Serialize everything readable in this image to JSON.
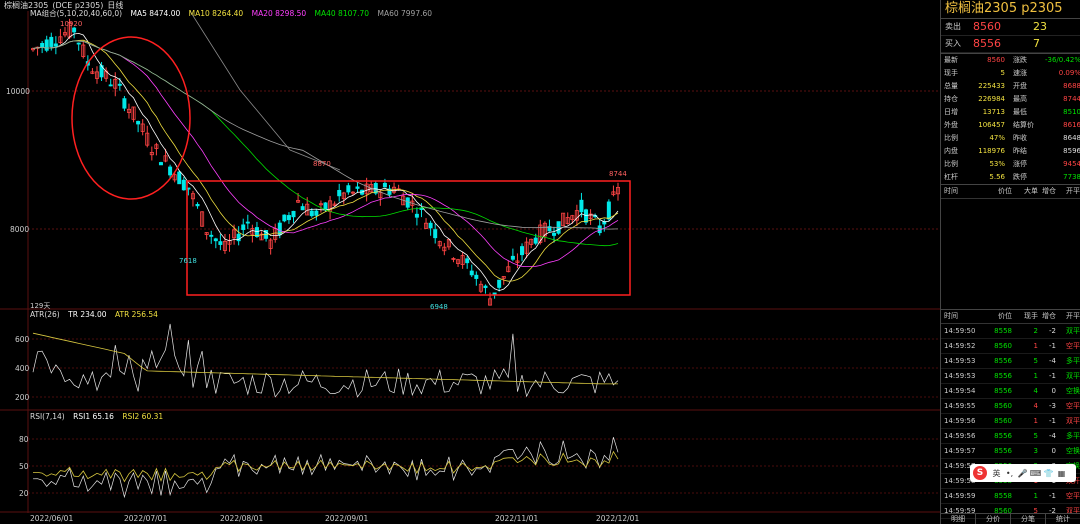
{
  "header": {
    "title": "棕榈油2305",
    "code": "(DCE p2305)",
    "period": "日线"
  },
  "ma_legend": {
    "group": "MA组合(5,10,20,40,60,0)",
    "ma5": "MA5 8474.00",
    "ma10": "MA10 8264.40",
    "ma20": "MA20 8298.50",
    "ma40": "MA40 8107.70",
    "ma60": "MA60 7997.60"
  },
  "atr_legend": {
    "name": "ATR(26)",
    "tr": "TR 234.00",
    "atr": "ATR 256.54"
  },
  "rsi_legend": {
    "name": "RSI(7,14)",
    "rsi1": "RSI1 65.16",
    "rsi2": "RSI2 60.31"
  },
  "days_label": "129天",
  "price_annotations": {
    "high_left": "10920",
    "peak_mid": "8870",
    "low_left": "7618",
    "low_mid": "6948",
    "high_right": "8744"
  },
  "y_axis_main": [
    "10000",
    "8000"
  ],
  "y_axis_atr": [
    "600",
    "400",
    "200"
  ],
  "y_axis_rsi": [
    "80",
    "50",
    "20"
  ],
  "x_axis": [
    "2022/06/01",
    "2022/07/01",
    "2022/08/01",
    "2022/09/01",
    "2022/11/01",
    "2022/12/01"
  ],
  "panel": {
    "title": "棕榈油2305  p2305",
    "ask": {
      "label": "卖出",
      "price": "8560",
      "qty": "23"
    },
    "bid": {
      "label": "买入",
      "price": "8556",
      "qty": "7"
    },
    "quotes": [
      {
        "k1": "最新",
        "v1": "8560",
        "k2": "涨跌",
        "v2": "-36/0.42%",
        "c1": "#ff4444",
        "c2": "#00e000"
      },
      {
        "k1": "现手",
        "v1": "5",
        "k2": "速涨",
        "v2": "0.09%",
        "c1": "#f0e040",
        "c2": "#ff4444"
      },
      {
        "k1": "总量",
        "v1": "225433",
        "k2": "开盘",
        "v2": "8688",
        "c1": "#f0e040",
        "c2": "#ff4444"
      },
      {
        "k1": "持仓",
        "v1": "226984",
        "k2": "最高",
        "v2": "8744",
        "c1": "#f0e040",
        "c2": "#ff4444"
      },
      {
        "k1": "日增",
        "v1": "13713",
        "k2": "最低",
        "v2": "8510",
        "c1": "#f0e040",
        "c2": "#00e000"
      },
      {
        "k1": "外盘",
        "v1": "106457",
        "k2": "结算价",
        "v2": "8616",
        "c1": "#f0e040",
        "c2": "#ff4444"
      },
      {
        "k1": "比例",
        "v1": "47%",
        "k2": "昨收",
        "v2": "8648",
        "c1": "#f0e040",
        "c2": "#dddddd"
      },
      {
        "k1": "内盘",
        "v1": "118976",
        "k2": "昨结",
        "v2": "8596",
        "c1": "#f0e040",
        "c2": "#dddddd"
      },
      {
        "k1": "比例",
        "v1": "53%",
        "k2": "涨停",
        "v2": "9454",
        "c1": "#f0e040",
        "c2": "#ff4444"
      },
      {
        "k1": "杠杆",
        "v1": "5.56",
        "k2": "跌停",
        "v2": "7738",
        "c1": "#f0e040",
        "c2": "#00e000"
      }
    ],
    "head1": [
      "时间",
      "价位",
      "大单",
      "增仓",
      "开平"
    ],
    "head2": [
      "时间",
      "价位",
      "现手",
      "增仓",
      "开平"
    ],
    "ticks": [
      {
        "t": "14:59:50",
        "p": "8558",
        "q": "2",
        "d": "-2",
        "o": "双平",
        "pc": "#00e000",
        "qc": "#00e000",
        "oc": "#00e000"
      },
      {
        "t": "14:59:52",
        "p": "8560",
        "q": "1",
        "d": "-1",
        "o": "空平",
        "pc": "#00e000",
        "qc": "#ff4444",
        "oc": "#ff4444"
      },
      {
        "t": "14:59:53",
        "p": "8556",
        "q": "5",
        "d": "-4",
        "o": "多平",
        "pc": "#00e000",
        "qc": "#00e000",
        "oc": "#00e000"
      },
      {
        "t": "14:59:53",
        "p": "8556",
        "q": "1",
        "d": "-1",
        "o": "双平",
        "pc": "#00e000",
        "qc": "#00e000",
        "oc": "#00e000"
      },
      {
        "t": "14:59:54",
        "p": "8556",
        "q": "4",
        "d": "0",
        "o": "空换",
        "pc": "#00e000",
        "qc": "#00e000",
        "oc": "#00e000"
      },
      {
        "t": "14:59:55",
        "p": "8560",
        "q": "4",
        "d": "-3",
        "o": "空平",
        "pc": "#00e000",
        "qc": "#ff4444",
        "oc": "#ff4444"
      },
      {
        "t": "14:59:56",
        "p": "8560",
        "q": "1",
        "d": "-1",
        "o": "双平",
        "pc": "#00e000",
        "qc": "#ff4444",
        "oc": "#ff4444"
      },
      {
        "t": "14:59:56",
        "p": "8556",
        "q": "5",
        "d": "-4",
        "o": "多平",
        "pc": "#00e000",
        "qc": "#00e000",
        "oc": "#00e000"
      },
      {
        "t": "14:59:57",
        "p": "8556",
        "q": "3",
        "d": "0",
        "o": "空换",
        "pc": "#00e000",
        "qc": "#00e000",
        "oc": "#00e000"
      },
      {
        "t": "14:59:57",
        "p": "8556",
        "q": "2",
        "d": "0",
        "o": "空换",
        "pc": "#00e000",
        "qc": "#00e000",
        "oc": "#00e000"
      },
      {
        "t": "14:59:58",
        "p": "8558",
        "q": "1",
        "d": "1",
        "o": "双开",
        "pc": "#00e000",
        "qc": "#ff4444",
        "oc": "#ff4444"
      },
      {
        "t": "14:59:59",
        "p": "8558",
        "q": "1",
        "d": "-1",
        "o": "空平",
        "pc": "#00e000",
        "qc": "#00e000",
        "oc": "#ff4444"
      },
      {
        "t": "14:59:59",
        "p": "8560",
        "q": "5",
        "d": "-2",
        "o": "双平",
        "pc": "#00e000",
        "qc": "#ff4444",
        "oc": "#ff4444"
      }
    ],
    "tabs": [
      "明细",
      "分价",
      "分笔",
      "统计"
    ]
  },
  "ime": {
    "logo": "S",
    "lang": "英"
  },
  "colors": {
    "up": "#ff4444",
    "down": "#00e8e8",
    "ma5": "#ffffff",
    "ma10": "#f0e040",
    "ma20": "#ff40ff",
    "ma40": "#00e000",
    "ma60": "#a0a0a0",
    "annot": "#ff2020"
  }
}
